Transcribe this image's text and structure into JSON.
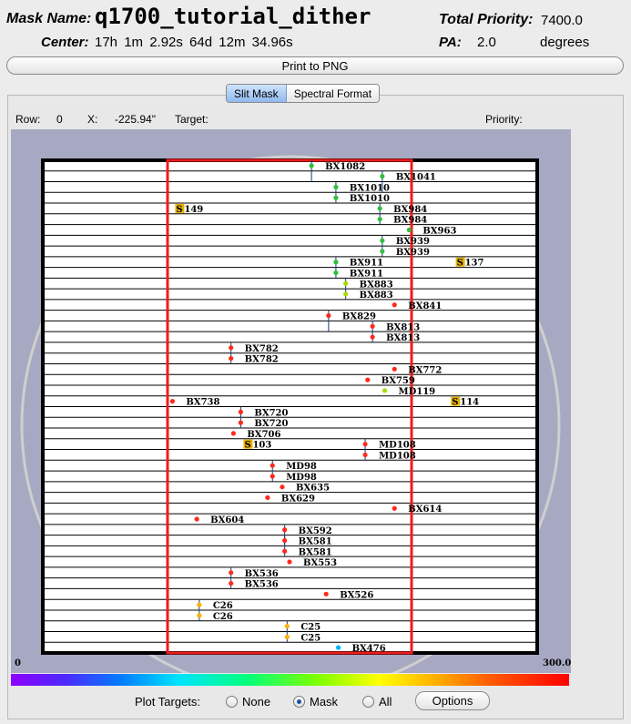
{
  "header": {
    "mask_name_label": "Mask Name:",
    "mask_name": "q1700_tutorial_dither",
    "total_priority_label": "Total Priority:",
    "total_priority": "7400.0",
    "center_label": "Center:",
    "center_value": "17h 1m 2.92s   64d 12m 34.96s",
    "pa_label": "PA:",
    "pa_value": "2.0",
    "pa_unit": "degrees"
  },
  "print_button": "Print to PNG",
  "tabs": [
    {
      "label": "Slit Mask",
      "active": true
    },
    {
      "label": "Spectral Format",
      "active": false
    }
  ],
  "info": {
    "row_label": "Row:",
    "row_value": "0",
    "x_label": "X:",
    "x_value": "-225.94\"",
    "target_label": "Target:",
    "priority_label": "Priority:"
  },
  "plot": {
    "x_min_label": "0",
    "x_max_label": "300.0",
    "background_color": "#a7a9c3",
    "slit_count": 46,
    "targets": [
      {
        "name": "BX1082",
        "row": 0,
        "slit_x": 0.6,
        "marker_x": 0.59,
        "color": "#2fbf3a",
        "line": true
      },
      {
        "name": "BX1041",
        "row": 1,
        "slit_x": 0.89,
        "marker_x": 0.88,
        "color": "#2fbf3a",
        "line": true
      },
      {
        "name": "BX1010",
        "row": 2,
        "slit_x": 0.7,
        "marker_x": 0.69,
        "color": "#2fbf3a",
        "line": true
      },
      {
        "name": "BX1010",
        "row": 3,
        "slit_x": 0.7,
        "marker_x": 0.69,
        "color": "#2fbf3a",
        "line": false
      },
      {
        "name": "149",
        "row": 4,
        "slit_x": 0.06,
        "marker_x": 0.05,
        "color": "#e5b000",
        "line": false,
        "box": "S"
      },
      {
        "name": "BX984",
        "row": 4,
        "slit_x": 0.87,
        "marker_x": 0.87,
        "color": "#2fbf3a",
        "line": true
      },
      {
        "name": "BX984",
        "row": 5,
        "slit_x": 0.87,
        "marker_x": 0.87,
        "color": "#2fbf3a",
        "line": false
      },
      {
        "name": "BX963",
        "row": 6,
        "slit_x": 1.05,
        "marker_x": 0.99,
        "color": "#2fbf3a",
        "line": false
      },
      {
        "name": "BX939",
        "row": 7,
        "slit_x": 0.94,
        "marker_x": 0.88,
        "color": "#2fbf3a",
        "line": true
      },
      {
        "name": "BX939",
        "row": 8,
        "slit_x": 0.94,
        "marker_x": 0.88,
        "color": "#2fbf3a",
        "line": false
      },
      {
        "name": "BX911",
        "row": 9,
        "slit_x": 0.73,
        "marker_x": 0.69,
        "color": "#2fbf3a",
        "line": true
      },
      {
        "name": "BX911",
        "row": 10,
        "slit_x": 0.73,
        "marker_x": 0.69,
        "color": "#2fbf3a",
        "line": false
      },
      {
        "name": "137",
        "row": 9,
        "slit_x": 1.2,
        "marker_x": 1.2,
        "color": "#e5b000",
        "line": false,
        "box": "S"
      },
      {
        "name": "BX883",
        "row": 11,
        "slit_x": 0.74,
        "marker_x": 0.73,
        "color": "#a6dd00",
        "line": true
      },
      {
        "name": "BX883",
        "row": 12,
        "slit_x": 0.74,
        "marker_x": 0.73,
        "color": "#a6dd00",
        "line": false
      },
      {
        "name": "BX841",
        "row": 13,
        "slit_x": 1.0,
        "marker_x": 0.93,
        "color": "#ff2a1a",
        "line": false
      },
      {
        "name": "BX829",
        "row": 14,
        "slit_x": 0.7,
        "marker_x": 0.66,
        "color": "#ff2a1a",
        "line": true
      },
      {
        "name": "BX813",
        "row": 15,
        "slit_x": 0.85,
        "marker_x": 0.84,
        "color": "#ff2a1a",
        "line": true
      },
      {
        "name": "BX813",
        "row": 16,
        "slit_x": 0.85,
        "marker_x": 0.84,
        "color": "#ff2a1a",
        "line": false
      },
      {
        "name": "BX782",
        "row": 17,
        "slit_x": 0.27,
        "marker_x": 0.26,
        "color": "#ff2a1a",
        "line": true
      },
      {
        "name": "BX782",
        "row": 18,
        "slit_x": 0.27,
        "marker_x": 0.26,
        "color": "#ff2a1a",
        "line": false
      },
      {
        "name": "BX772",
        "row": 19,
        "slit_x": 1.0,
        "marker_x": 0.93,
        "color": "#ff2a1a",
        "line": false
      },
      {
        "name": "BX759",
        "row": 20,
        "slit_x": 0.82,
        "marker_x": 0.82,
        "color": "#ff2a1a",
        "line": false
      },
      {
        "name": "MD119",
        "row": 21,
        "slit_x": 0.9,
        "marker_x": 0.89,
        "color": "#a6dd00",
        "line": false
      },
      {
        "name": "BX738",
        "row": 22,
        "slit_x": 0.07,
        "marker_x": 0.02,
        "color": "#ff2a1a",
        "line": false
      },
      {
        "name": "114",
        "row": 22,
        "slit_x": 1.18,
        "marker_x": 1.18,
        "color": "#e5b000",
        "line": false,
        "box": "S"
      },
      {
        "name": "BX720",
        "row": 23,
        "slit_x": 0.37,
        "marker_x": 0.3,
        "color": "#ff2a1a",
        "line": true
      },
      {
        "name": "BX720",
        "row": 24,
        "slit_x": 0.37,
        "marker_x": 0.3,
        "color": "#ff2a1a",
        "line": false
      },
      {
        "name": "BX706",
        "row": 25,
        "slit_x": 0.28,
        "marker_x": 0.27,
        "color": "#ff2a1a",
        "line": false
      },
      {
        "name": "103",
        "row": 26,
        "slit_x": 0.33,
        "marker_x": 0.33,
        "color": "#e5b000",
        "line": false,
        "box": "S"
      },
      {
        "name": "MD108",
        "row": 26,
        "slit_x": 0.87,
        "marker_x": 0.81,
        "color": "#ff2a1a",
        "line": true
      },
      {
        "name": "MD108",
        "row": 27,
        "slit_x": 0.87,
        "marker_x": 0.81,
        "color": "#ff2a1a",
        "line": false
      },
      {
        "name": "MD98",
        "row": 28,
        "slit_x": 0.5,
        "marker_x": 0.43,
        "color": "#ff2a1a",
        "line": true
      },
      {
        "name": "MD98",
        "row": 29,
        "slit_x": 0.5,
        "marker_x": 0.43,
        "color": "#ff2a1a",
        "line": false
      },
      {
        "name": "BX635",
        "row": 30,
        "slit_x": 0.53,
        "marker_x": 0.47,
        "color": "#ff2a1a",
        "line": false
      },
      {
        "name": "BX629",
        "row": 31,
        "slit_x": 0.47,
        "marker_x": 0.41,
        "color": "#ff2a1a",
        "line": false
      },
      {
        "name": "BX614",
        "row": 32,
        "slit_x": 1.0,
        "marker_x": 0.93,
        "color": "#ff2a1a",
        "line": false
      },
      {
        "name": "BX604",
        "row": 33,
        "slit_x": 0.18,
        "marker_x": 0.12,
        "color": "#ff2a1a",
        "line": false
      },
      {
        "name": "BX592",
        "row": 34,
        "slit_x": 0.55,
        "marker_x": 0.48,
        "color": "#ff2a1a",
        "line": true
      },
      {
        "name": "BX581",
        "row": 35,
        "slit_x": 0.55,
        "marker_x": 0.48,
        "color": "#ff2a1a",
        "line": true
      },
      {
        "name": "BX581",
        "row": 36,
        "slit_x": 0.55,
        "marker_x": 0.48,
        "color": "#ff2a1a",
        "line": false
      },
      {
        "name": "BX553",
        "row": 37,
        "slit_x": 0.56,
        "marker_x": 0.5,
        "color": "#ff2a1a",
        "line": false
      },
      {
        "name": "BX536",
        "row": 38,
        "slit_x": 0.27,
        "marker_x": 0.26,
        "color": "#ff2a1a",
        "line": true
      },
      {
        "name": "BX536",
        "row": 39,
        "slit_x": 0.27,
        "marker_x": 0.26,
        "color": "#ff2a1a",
        "line": false
      },
      {
        "name": "BX526",
        "row": 40,
        "slit_x": 0.71,
        "marker_x": 0.65,
        "color": "#ff2a1a",
        "line": false
      },
      {
        "name": "C26",
        "row": 41,
        "slit_x": 0.19,
        "marker_x": 0.13,
        "color": "#ffb000",
        "line": true
      },
      {
        "name": "C26",
        "row": 42,
        "slit_x": 0.19,
        "marker_x": 0.13,
        "color": "#ffb000",
        "line": false
      },
      {
        "name": "C25",
        "row": 43,
        "slit_x": 0.55,
        "marker_x": 0.49,
        "color": "#ffb000",
        "line": true
      },
      {
        "name": "C25",
        "row": 44,
        "slit_x": 0.55,
        "marker_x": 0.49,
        "color": "#ffb000",
        "line": false
      },
      {
        "name": "BX476",
        "row": 45,
        "slit_x": 0.76,
        "marker_x": 0.7,
        "color": "#00b4ff",
        "line": false
      }
    ]
  },
  "plot_targets": {
    "label": "Plot Targets:",
    "options": [
      {
        "label": "None",
        "selected": false
      },
      {
        "label": "Mask",
        "selected": true
      },
      {
        "label": "All",
        "selected": false
      }
    ],
    "options_button": "Options"
  }
}
